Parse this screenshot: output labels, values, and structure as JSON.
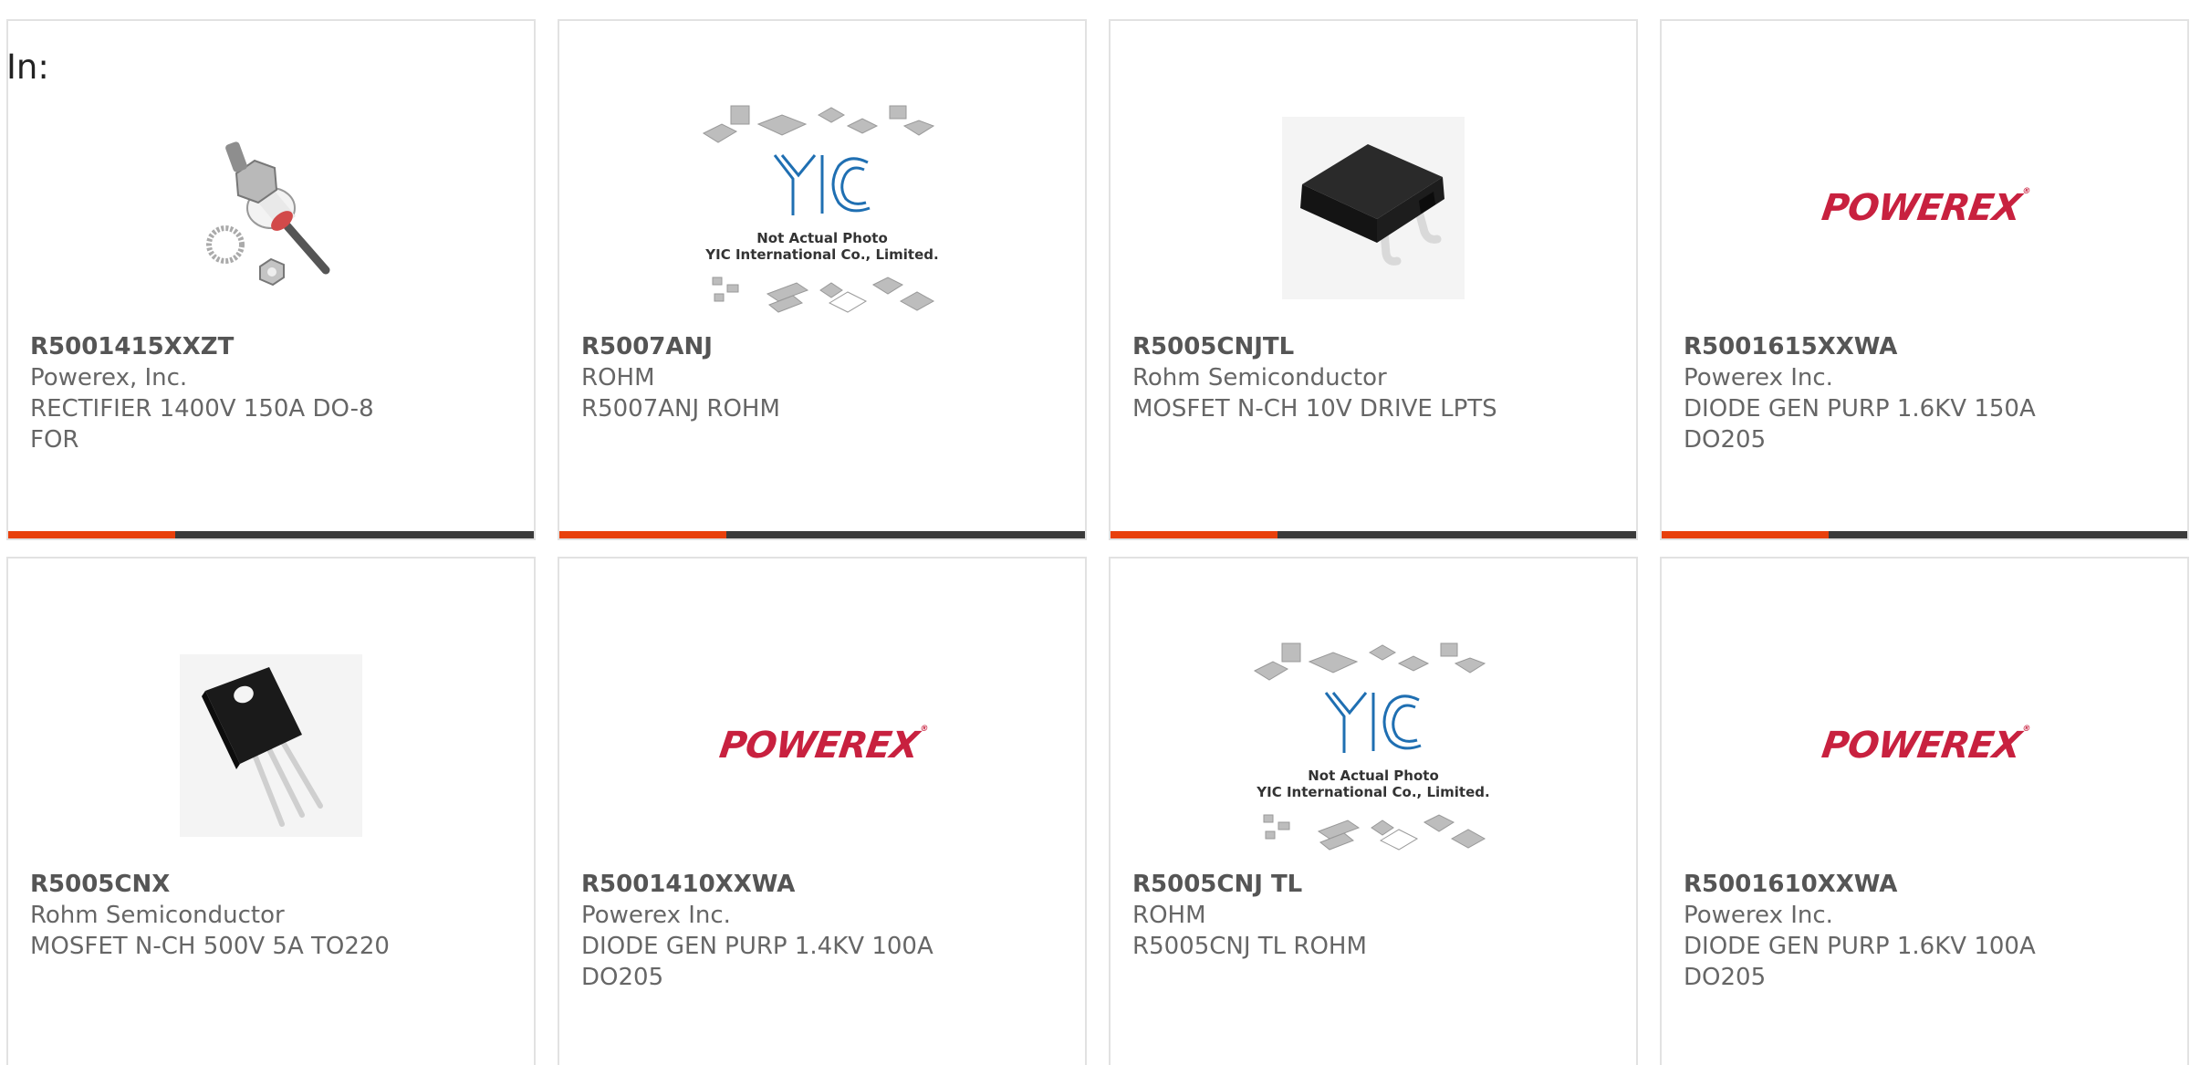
{
  "filter": {
    "label": "In:"
  },
  "colors": {
    "accent": "#e8400c",
    "bar": "#3a3a3a",
    "powerex_brand": "#c8213f"
  },
  "products": [
    {
      "part_number": "R5001415XXZT",
      "manufacturer": "Powerex, Inc.",
      "description": "RECTIFIER 1400V 150A DO-8",
      "description2": "FOR",
      "image": "stud-rectifier-photo"
    },
    {
      "part_number": "R5007ANJ",
      "manufacturer": "ROHM",
      "description": "R5007ANJ ROHM",
      "description2": "",
      "image": "yic-placeholder",
      "image_text": [
        "Not Actual Photo",
        "YIC International Co., Limited."
      ]
    },
    {
      "part_number": "R5005CNJTL",
      "manufacturer": "Rohm Semiconductor",
      "description": "MOSFET N-CH 10V DRIVE LPTS",
      "description2": "",
      "image": "smd-package-photo"
    },
    {
      "part_number": "R5001615XXWA",
      "manufacturer": "Powerex Inc.",
      "description": "DIODE GEN PURP 1.6KV 150A",
      "description2": "DO205",
      "image": "powerex-logo",
      "logo_text": "POWEREX"
    },
    {
      "part_number": "R5005CNX",
      "manufacturer": "Rohm Semiconductor",
      "description": "MOSFET N-CH 500V 5A TO220",
      "description2": "",
      "image": "to220-photo"
    },
    {
      "part_number": "R5001410XXWA",
      "manufacturer": "Powerex Inc.",
      "description": "DIODE GEN PURP 1.4KV 100A",
      "description2": "DO205",
      "image": "powerex-logo",
      "logo_text": "POWEREX"
    },
    {
      "part_number": "R5005CNJ TL",
      "manufacturer": "ROHM",
      "description": "R5005CNJ TL ROHM",
      "description2": "",
      "image": "yic-placeholder",
      "image_text": [
        "Not Actual Photo",
        "YIC International Co., Limited."
      ]
    },
    {
      "part_number": "R5001610XXWA",
      "manufacturer": "Powerex Inc.",
      "description": "DIODE GEN PURP 1.6KV 100A",
      "description2": "DO205",
      "image": "powerex-logo",
      "logo_text": "POWEREX"
    }
  ]
}
